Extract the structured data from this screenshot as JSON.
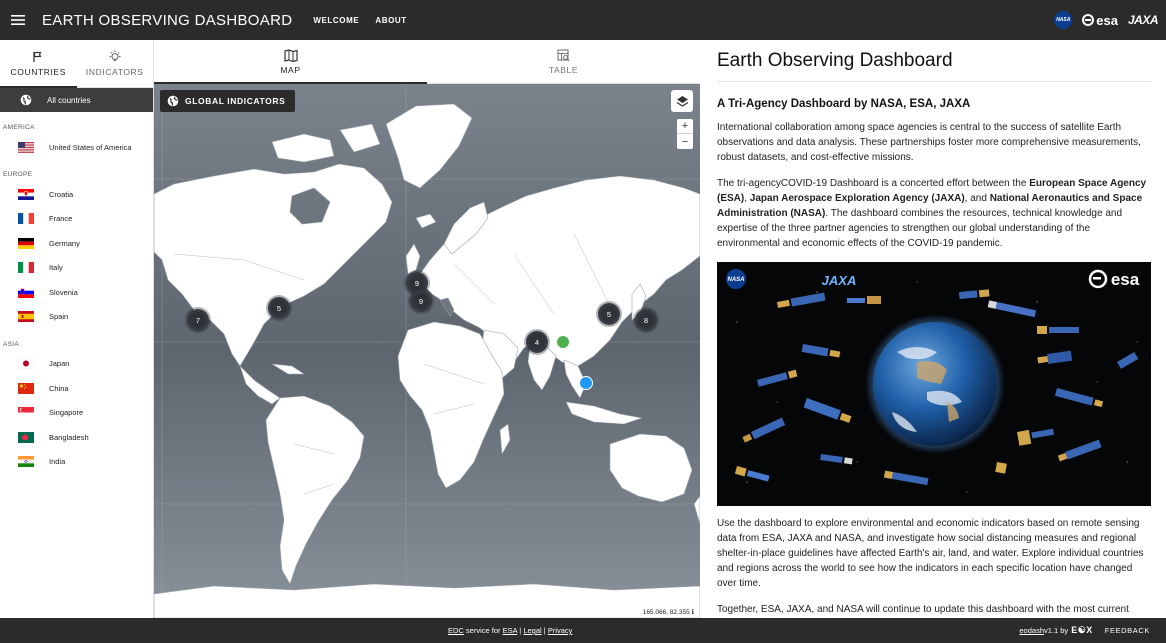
{
  "header": {
    "title": "EARTH OBSERVING DASHBOARD",
    "nav": [
      "WELCOME",
      "ABOUT"
    ],
    "logos": {
      "nasa": "NASA",
      "esa": "esa",
      "jaxa": "JAXA"
    }
  },
  "sidebar": {
    "tabs": [
      {
        "label": "COUNTRIES",
        "icon": "flag-icon"
      },
      {
        "label": "INDICATORS",
        "icon": "lightbulb-icon"
      }
    ],
    "all_countries": "All countries",
    "regions": [
      {
        "name": "AMERICA",
        "countries": [
          "United States of America"
        ]
      },
      {
        "name": "EUROPE",
        "countries": [
          "Croatia",
          "France",
          "Germany",
          "Italy",
          "Slovenia",
          "Spain"
        ]
      },
      {
        "name": "ASIA",
        "countries": [
          "Japan",
          "China",
          "Singapore",
          "Bangladesh",
          "India"
        ]
      }
    ]
  },
  "map": {
    "tabs": [
      {
        "label": "MAP",
        "icon": "map-icon"
      },
      {
        "label": "TABLE",
        "icon": "table-icon"
      }
    ],
    "global_button": "GLOBAL INDICATORS",
    "zoom_in": "+",
    "zoom_out": "−",
    "coordinates": "165.066, 82.355",
    "clusters": [
      "7",
      "5",
      "9",
      "9",
      "4",
      "5",
      "8"
    ]
  },
  "content": {
    "title": "Earth Observing Dashboard",
    "subtitle": "A Tri-Agency Dashboard by NASA, ESA, JAXA",
    "p1": "International collaboration among space agencies is central to the success of satellite Earth observations and data analysis. These partnerships foster more comprehensive measurements, robust datasets, and cost-effective missions.",
    "p2_a": "The tri-agencyCOVID-19 Dashboard is a concerted effort between the ",
    "p2_esa": "European Space Agency (ESA)",
    "p2_b": ", ",
    "p2_jaxa": "Japan Aerospace Exploration Agency (JAXA)",
    "p2_c": ", and ",
    "p2_nasa": "National Aeronautics and Space Administration (NASA)",
    "p2_d": ". The dashboard combines the resources, technical knowledge and expertise of the three partner agencies to strengthen our global understanding of the environmental and economic effects of the COVID-19 pandemic.",
    "hero_logos": {
      "nasa": "NASA",
      "jaxa": "JAXA",
      "esa": "esa"
    },
    "p3": "Use the dashboard to explore environmental and economic indicators based on remote sensing data from ESA, JAXA and NASA, and investigate how social distancing measures and regional shelter-in-place guidelines have affected Earth's air, land, and water. Explore individual countries and regions across the world to see how the indicators in each specific location have changed over time.",
    "p4": "Together, ESA, JAXA, and NASA will continue to update this dashboard with the most current information."
  },
  "footer": {
    "edc": "EDC",
    "service_for": " service for ",
    "esa": "ESA",
    "sep1": " | ",
    "legal": "Legal",
    "sep2": " | ",
    "privacy": "Privacy",
    "version": "eodash",
    "version_num": " v1.1 by ",
    "eox": "E☯X",
    "feedback": "FEEDBACK"
  }
}
